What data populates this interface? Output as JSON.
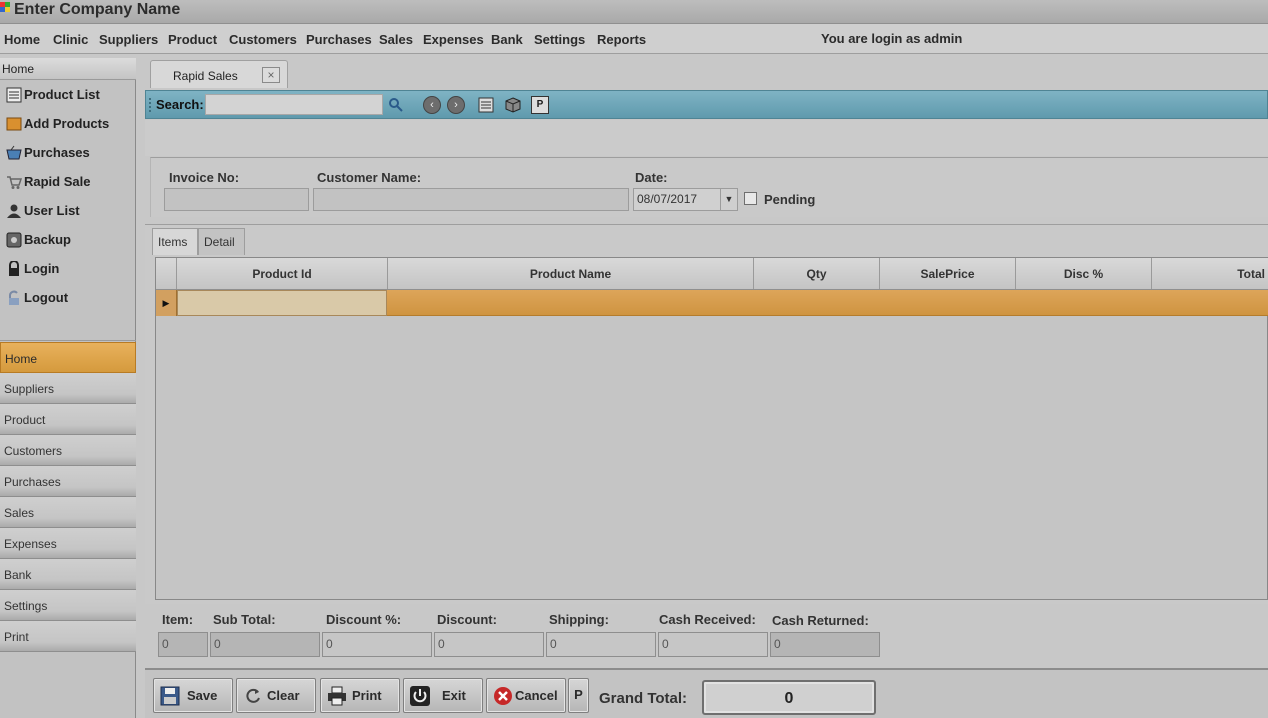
{
  "app": {
    "title": "Enter Company Name"
  },
  "menu": {
    "items": [
      "Home",
      "Clinic",
      "Suppliers",
      "Product",
      "Customers",
      "Purchases",
      "Sales",
      "Expenses",
      "Bank",
      "Settings",
      "Reports"
    ],
    "login_text": "You are login as admin"
  },
  "sidebar": {
    "breadcrumb": "Home",
    "nav": [
      {
        "label": "Product List",
        "icon": "list-icon"
      },
      {
        "label": "Add Products",
        "icon": "box-icon"
      },
      {
        "label": "Purchases",
        "icon": "basket-icon"
      },
      {
        "label": "Rapid Sale",
        "icon": "cart-icon"
      },
      {
        "label": "User List",
        "icon": "user-icon"
      },
      {
        "label": "Backup",
        "icon": "disk-icon"
      },
      {
        "label": "Login",
        "icon": "lock-icon"
      },
      {
        "label": "Logout",
        "icon": "unlock-icon"
      }
    ],
    "panels": [
      "Home",
      "Suppliers",
      "Product",
      "Customers",
      "Purchases",
      "Sales",
      "Expenses",
      "Bank",
      "Settings",
      "Print"
    ],
    "active_panel": "Home"
  },
  "tab": {
    "label": "Rapid Sales",
    "close": "×"
  },
  "search": {
    "label": "Search:",
    "value": "",
    "print_label": "P"
  },
  "form": {
    "invoice_label": "Invoice No:",
    "invoice_value": "",
    "customer_label": "Customer Name:",
    "customer_value": "",
    "date_label": "Date:",
    "date_value": "08/07/2017",
    "pending_label": "Pending",
    "pending_checked": false
  },
  "inner_tabs": [
    "Items",
    "Detail"
  ],
  "grid": {
    "columns": [
      "Product Id",
      "Product Name",
      "Qty",
      "SalePrice",
      "Disc %",
      "Total"
    ],
    "rows": [
      {
        "product_id": "",
        "product_name": "",
        "qty": "",
        "sale_price": "",
        "disc": "",
        "total": ""
      }
    ]
  },
  "totals": {
    "item_label": "Item:",
    "item_value": "0",
    "subtotal_label": "Sub Total:",
    "subtotal_value": "0",
    "discount_pct_label": "Discount %:",
    "discount_pct_value": "0",
    "discount_label": "Discount:",
    "discount_value": "0",
    "shipping_label": "Shipping:",
    "shipping_value": "0",
    "cash_received_label": "Cash Received:",
    "cash_received_value": "0",
    "cash_returned_label": "Cash Returned:",
    "cash_returned_value": "0"
  },
  "buttons": {
    "save": "Save",
    "clear": "Clear",
    "print": "Print",
    "exit": "Exit",
    "cancel": "Cancel",
    "p": "P"
  },
  "grand_total": {
    "label": "Grand Total:",
    "value": "0"
  },
  "colors": {
    "accent": "#d59a3d",
    "toolbar": "#6fa7b9",
    "background": "#c8c8c8"
  }
}
